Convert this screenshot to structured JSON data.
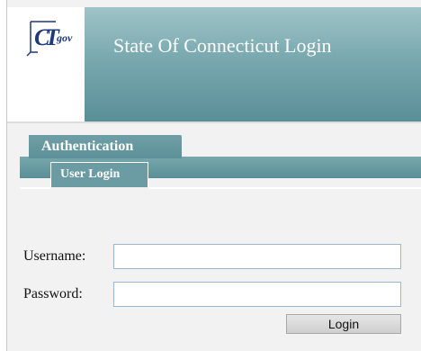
{
  "header": {
    "logo_text": "CTgov",
    "title": "State Of Connecticut Login"
  },
  "tabs": {
    "main_label": "Authentication",
    "sub_label": "User Login"
  },
  "form": {
    "username_label": "Username:",
    "username_value": "",
    "password_label": "Password:",
    "password_value": "",
    "login_label": "Login"
  },
  "colors": {
    "banner": "#5a8f97",
    "tab": "#6c9ca3",
    "input_border": "#9bb7cc"
  }
}
